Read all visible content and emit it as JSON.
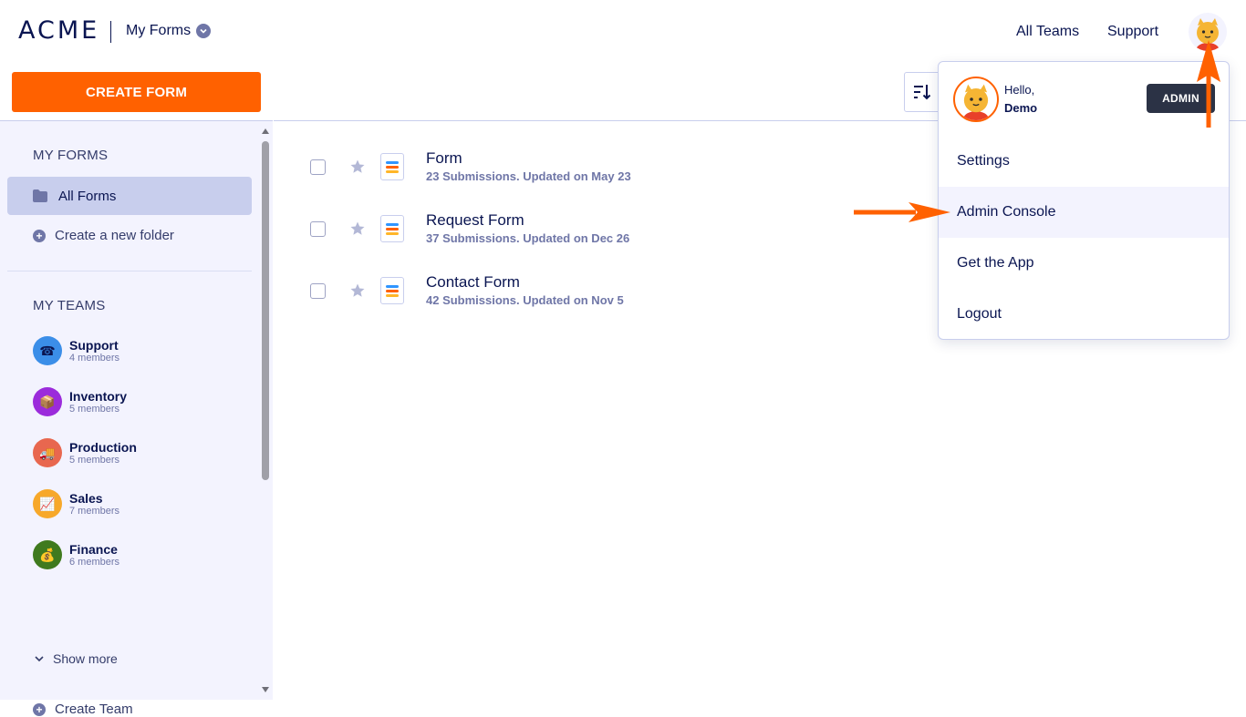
{
  "header": {
    "logo": "ACME",
    "title": "My Forms",
    "nav": [
      "All Teams",
      "Support"
    ]
  },
  "sidebar": {
    "create_label": "CREATE FORM",
    "my_forms_title": "MY FORMS",
    "all_forms_label": "All Forms",
    "new_folder_label": "Create a new folder",
    "my_teams_title": "MY TEAMS",
    "teams": [
      {
        "name": "Support",
        "members": "4 members",
        "color": "#3b8ee8",
        "emoji": "☎"
      },
      {
        "name": "Inventory",
        "members": "5 members",
        "color": "#9b2bdb",
        "emoji": "📦"
      },
      {
        "name": "Production",
        "members": "5 members",
        "color": "#e8674f",
        "emoji": "🚚"
      },
      {
        "name": "Sales",
        "members": "7 members",
        "color": "#f7a82a",
        "emoji": "📈"
      },
      {
        "name": "Finance",
        "members": "6 members",
        "color": "#3f7a1e",
        "emoji": "💰"
      }
    ],
    "show_more_label": "Show more",
    "create_team_label": "Create Team"
  },
  "forms": [
    {
      "title": "Form",
      "meta": "23 Submissions. Updated on May 23"
    },
    {
      "title": "Request Form",
      "meta": "37 Submissions. Updated on Dec 26"
    },
    {
      "title": "Contact Form",
      "meta": "42 Submissions. Updated on Nov 5"
    }
  ],
  "user_menu": {
    "hello": "Hello,",
    "name": "Demo",
    "badge": "ADMIN",
    "items": [
      "Settings",
      "Admin Console",
      "Get the App",
      "Logout"
    ]
  },
  "colors": {
    "accent": "#ff6100",
    "navy": "#0a1551",
    "sidebar_bg": "#f3f3fe",
    "selected_bg": "#c8ceed"
  }
}
